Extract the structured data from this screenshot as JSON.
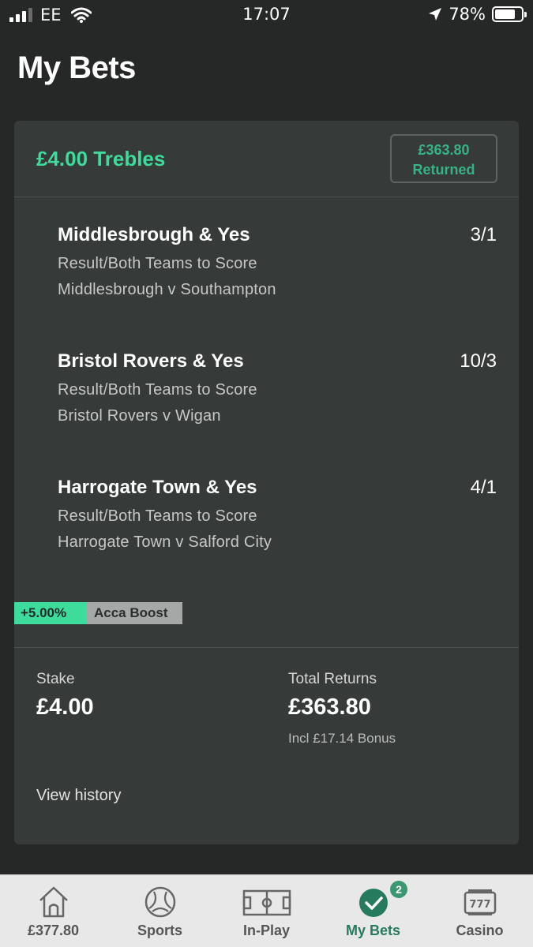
{
  "status_bar": {
    "carrier": "EE",
    "time": "17:07",
    "battery": "78%",
    "battery_level": 0.78
  },
  "page": {
    "title": "My Bets"
  },
  "bet": {
    "title": "£4.00 Trebles",
    "returned_amount": "£363.80",
    "returned_label": "Returned",
    "selections": [
      {
        "name": "Middlesbrough & Yes",
        "odds": "3/1",
        "market": "Result/Both Teams to Score",
        "event": "Middlesbrough v Southampton"
      },
      {
        "name": "Bristol Rovers & Yes",
        "odds": "10/3",
        "market": "Result/Both Teams to Score",
        "event": "Bristol Rovers v Wigan"
      },
      {
        "name": "Harrogate Town & Yes",
        "odds": "4/1",
        "market": "Result/Both Teams to Score",
        "event": "Harrogate Town v Salford City"
      }
    ],
    "boost_pct": "+5.00%",
    "boost_label": "Acca Boost",
    "stake_label": "Stake",
    "stake_value": "£4.00",
    "returns_label": "Total Returns",
    "returns_value": "£363.80",
    "bonus_text": "Incl £17.14 Bonus",
    "view_history": "View history"
  },
  "bottom_nav": {
    "items": [
      {
        "label": "£377.80",
        "icon": "home-icon"
      },
      {
        "label": "Sports",
        "icon": "football-icon"
      },
      {
        "label": "In-Play",
        "icon": "pitch-icon"
      },
      {
        "label": "My Bets",
        "icon": "check-circle-icon",
        "badge": "2"
      },
      {
        "label": "Casino",
        "icon": "slot-machine-icon"
      }
    ]
  },
  "colors": {
    "accent_green": "#3ddc9c",
    "returned_green": "#36b384",
    "active_nav": "#267a5d"
  }
}
